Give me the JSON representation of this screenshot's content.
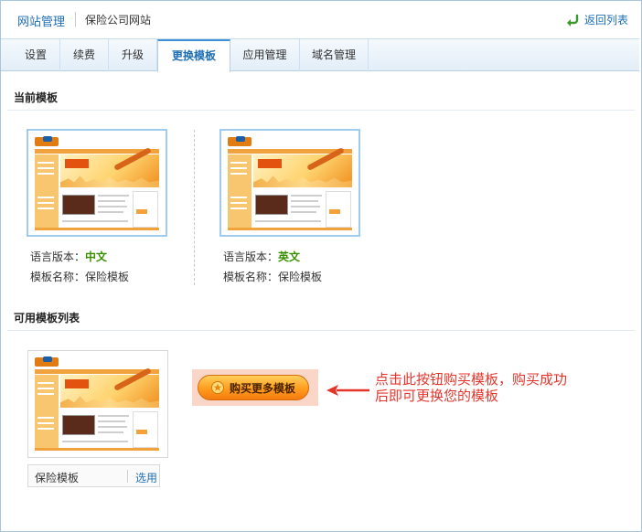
{
  "header": {
    "section": "网站管理",
    "site_name": "保险公司网站",
    "back_label": "返回列表"
  },
  "tabs": [
    {
      "label": "设置",
      "active": false
    },
    {
      "label": "续费",
      "active": false
    },
    {
      "label": "升级",
      "active": false
    },
    {
      "label": "更换模板",
      "active": true
    },
    {
      "label": "应用管理",
      "active": false
    },
    {
      "label": "域名管理",
      "active": false
    }
  ],
  "current": {
    "title": "当前模板",
    "templates": [
      {
        "lang_label": "语言版本：",
        "lang": "中文",
        "name_label": "模板名称：",
        "name": "保险模板"
      },
      {
        "lang_label": "语言版本：",
        "lang": "英文",
        "name_label": "模板名称：",
        "name": "保险模板"
      }
    ]
  },
  "available": {
    "title": "可用模板列表",
    "items": [
      {
        "name": "保险模板",
        "action": "选用"
      }
    ],
    "buy_label": "购买更多模板",
    "annotation": "点击此按钮购买模板，购买成功后即可更换您的模板"
  },
  "colors": {
    "accent": "#1f6fb5",
    "lang_value": "#3a8f00",
    "annotation": "#e5352b",
    "buy_button": "#ff9d1e"
  }
}
